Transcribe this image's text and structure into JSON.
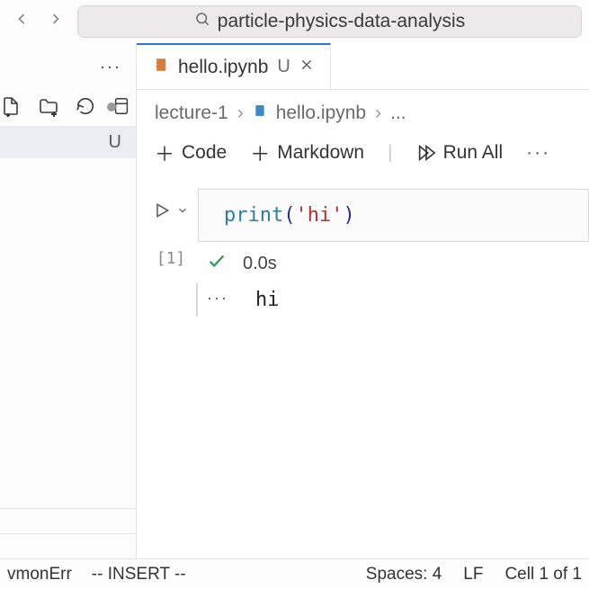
{
  "addressbar": {
    "text": "particle-physics-data-analysis"
  },
  "sidebar": {
    "file_status": "U"
  },
  "tab": {
    "filename": "hello.ipynb",
    "status": "U"
  },
  "breadcrumb": {
    "folder": "lecture-1",
    "file": "hello.ipynb",
    "tail": "..."
  },
  "toolbar": {
    "code": "Code",
    "markdown": "Markdown",
    "runall": "Run All"
  },
  "cell": {
    "exec_count": "[1]",
    "code": {
      "fn": "print",
      "open": "(",
      "str": "'hi'",
      "close": ")"
    },
    "exec_time": "0.0s",
    "output": "hi"
  },
  "statusbar": {
    "left1": "vmonErr",
    "mode": "-- INSERT --",
    "spaces": "Spaces: 4",
    "eol": "LF",
    "cell": "Cell 1 of 1"
  }
}
